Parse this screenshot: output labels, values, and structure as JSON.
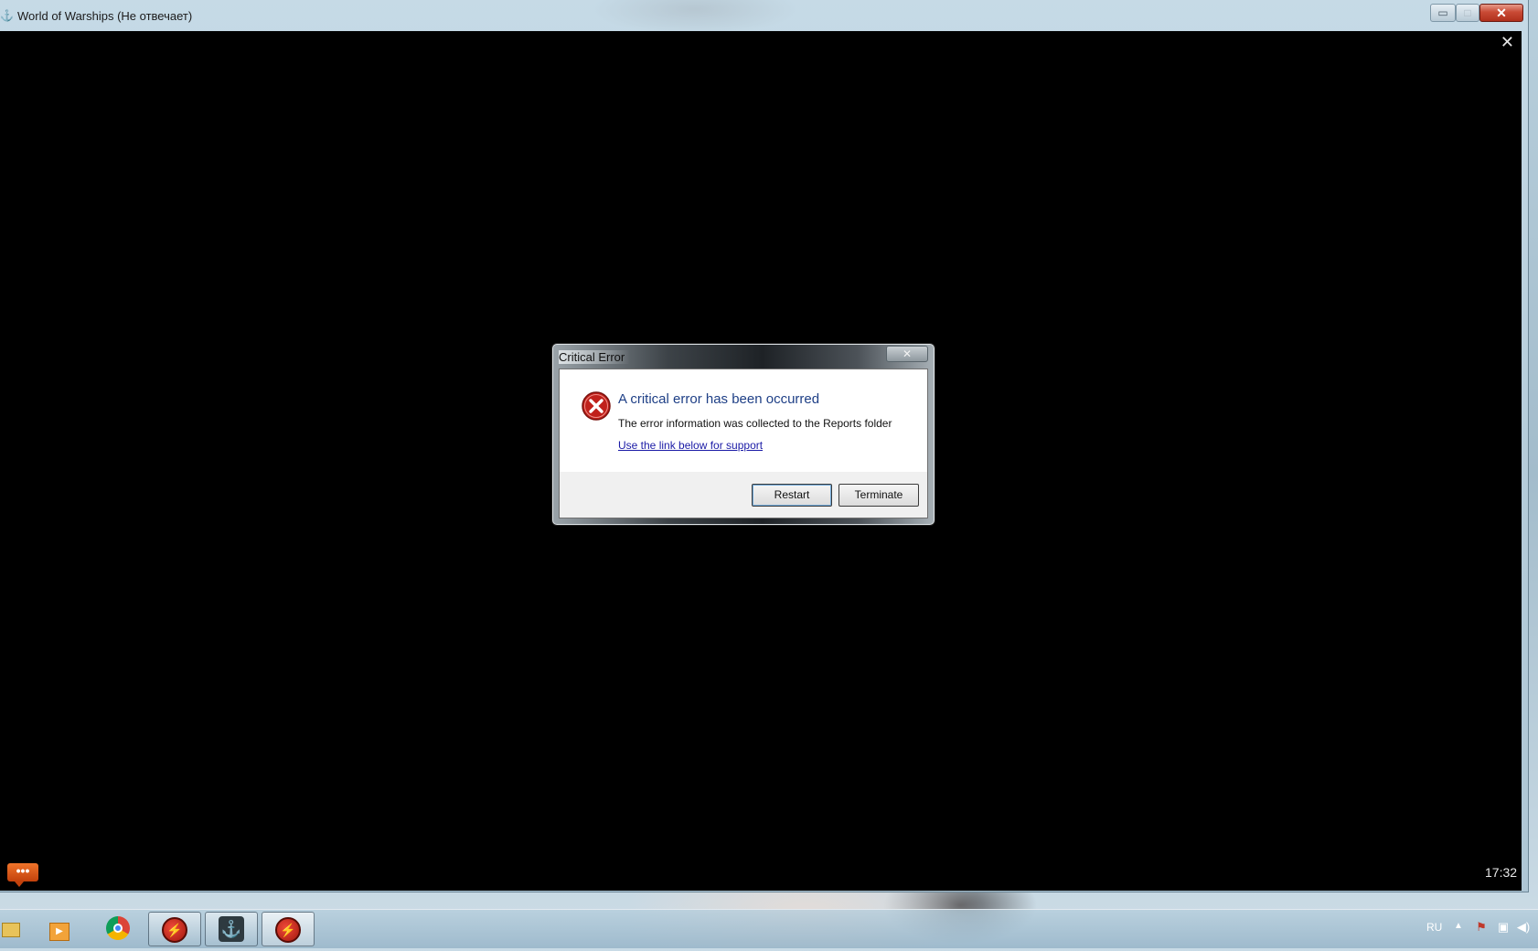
{
  "window": {
    "title": "World of Warships (Не отвечает)",
    "minimize_glyph": "▭",
    "maximize_glyph": "□",
    "close_glyph": "✕",
    "client_close_glyph": "✕"
  },
  "game": {
    "chat_glyph": "•••",
    "clock": "17:32"
  },
  "dialog": {
    "title": "Critical Error",
    "close_glyph": "✕",
    "heading": "A critical error has been occurred",
    "message": "The error information was collected to the Reports folder",
    "link": "Use the link below for support",
    "buttons": {
      "restart": "Restart",
      "terminate": "Terminate"
    }
  },
  "taskbar": {
    "items": [
      {
        "name": "explorer",
        "icon": "folder-icon"
      },
      {
        "name": "media-player",
        "icon": "media-player-icon"
      },
      {
        "name": "chrome",
        "icon": "chrome-icon"
      },
      {
        "name": "wargaming-center",
        "icon": "wargaming-icon"
      },
      {
        "name": "world-of-warships",
        "icon": "warships-anchor-icon"
      },
      {
        "name": "world-of-warships-active",
        "icon": "wargaming-icon"
      }
    ],
    "tray": {
      "language": "RU",
      "show_hidden_glyph": "▲",
      "icons": [
        "action-center-flag-icon",
        "network-icon",
        "volume-icon"
      ]
    }
  },
  "colors": {
    "dialog_heading": "#1e3f86",
    "link": "#1a1aa6",
    "close_button_red": "#c94b36",
    "chat_button_orange": "#e0641f",
    "error_icon_red": "#c0211b"
  }
}
